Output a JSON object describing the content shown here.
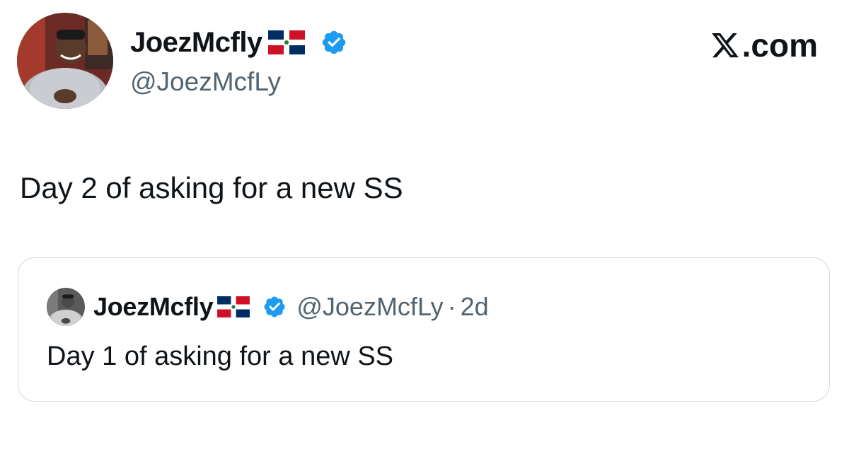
{
  "tweet": {
    "author": {
      "display_name": "JoezMcfly",
      "flag_icon": "dominican-republic-flag-icon",
      "verified_icon": "verified-badge-icon",
      "handle": "@JoezMcfLy"
    },
    "brand": {
      "logo_icon": "x-logo-icon",
      "label": ".com"
    },
    "text": "Day 2 of asking for a new SS",
    "quoted": {
      "author": {
        "display_name": "JoezMcfly",
        "flag_icon": "dominican-republic-flag-icon",
        "verified_icon": "verified-badge-icon",
        "handle": "@JoezMcfLy"
      },
      "separator": "·",
      "timestamp": "2d",
      "text": "Day 1 of asking for a new SS"
    }
  },
  "colors": {
    "text_primary": "#0f1419",
    "text_secondary": "#536471",
    "verified_blue": "#1d9bf0",
    "card_border": "#cfd9de",
    "flag_blue": "#002d62",
    "flag_red": "#ce1126"
  }
}
